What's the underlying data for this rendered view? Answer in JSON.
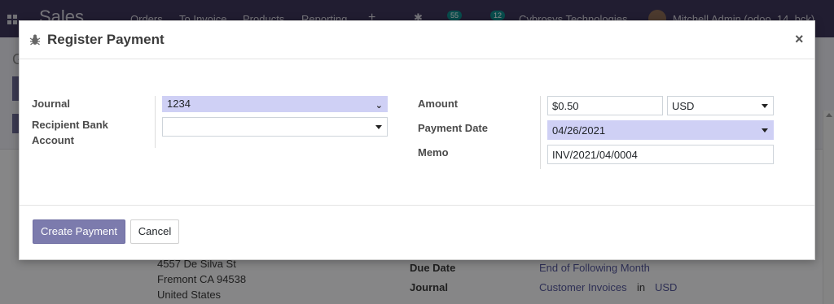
{
  "navbar": {
    "brand": "Sales",
    "menu": [
      "Orders",
      "To Invoice",
      "Products",
      "Reporting"
    ],
    "badge_1": "55",
    "badge_2": "12",
    "company": "Cybrosys Technologies",
    "user": "Mitchell Admin (odoo_14_bck)"
  },
  "background": {
    "address_lines": [
      "4557 De Silva St",
      "Fremont CA 94538",
      "United States"
    ],
    "due_date_label": "Due Date",
    "due_date_value": "End of Following Month",
    "journal_label": "Journal",
    "journal_value": "Customer Invoices",
    "journal_in": "in",
    "journal_currency": "USD"
  },
  "modal": {
    "title": "Register Payment",
    "close_glyph": "×",
    "journal_label": "Journal",
    "journal_value": "1234",
    "recipient_label_line1": "Recipient Bank",
    "recipient_label_line2": "Account",
    "recipient_value": "",
    "amount_label": "Amount",
    "amount_value": "$0.50",
    "currency_value": "USD",
    "payment_date_label": "Payment Date",
    "payment_date_value": "04/26/2021",
    "memo_label": "Memo",
    "memo_value": "INV/2021/04/0004",
    "create_button": "Create Payment",
    "cancel_button": "Cancel"
  },
  "colors": {
    "navbar": "#3d3659",
    "primary": "#7c7bad",
    "highlight": "#cfd0f5"
  },
  "icons": {
    "modal_title_icon": "bug-icon",
    "close": "close-icon"
  }
}
